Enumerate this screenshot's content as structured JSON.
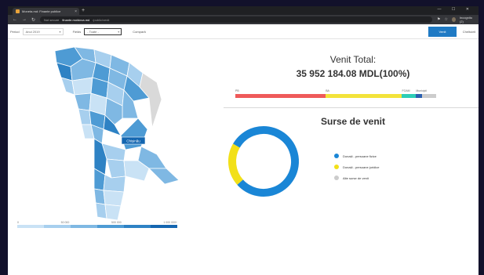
{
  "browser": {
    "tab_title": "Moneta.md: Finante publice",
    "tab_close": "×",
    "new_tab": "+",
    "window_controls": "— ☐ ✕",
    "security": "Not secure",
    "host": "finante.moldova.md",
    "path": "/public/venit",
    "user": "Incognito (2)"
  },
  "filters": {
    "period_label": "Period",
    "period_value": "Anul 2019",
    "fields_label": "Fields",
    "fields_value": "- Toate -",
    "compare_label": "Compară",
    "venit_button": "Venit",
    "cheltuieli_button": "Cheltuieli"
  },
  "map": {
    "tooltip": "Chișinău",
    "legend_ticks": [
      "0",
      "50 000",
      "500 000",
      "1 000 000+"
    ],
    "colors": [
      "#c9e2f5",
      "#a7cfee",
      "#7fb8e3",
      "#4e9bd4",
      "#2e82c4",
      "#1466b0"
    ]
  },
  "venit": {
    "title": "Venit Total:",
    "total": "35 952 184.08 MDL(100%)"
  },
  "stack": {
    "labels": [
      "PB",
      "BA",
      "FOAM",
      "Municipii"
    ],
    "colors": [
      "#ef5a5a",
      "#f3e33a",
      "#2dcdb6",
      "#2a5fb0",
      "#cccccc"
    ],
    "values": [
      0.45,
      0.38,
      0.07,
      0.03,
      0.07
    ]
  },
  "surse": {
    "title": "Surse de venit",
    "legend": [
      {
        "label": "Donații - persoane fizice",
        "color": "#1a86d6"
      },
      {
        "label": "Donații - persoane juridice",
        "color": "#f2e018"
      },
      {
        "label": "Alte surse de venit",
        "color": "#cccccc"
      }
    ],
    "values": [
      0.8,
      0.2,
      0.0
    ]
  }
}
